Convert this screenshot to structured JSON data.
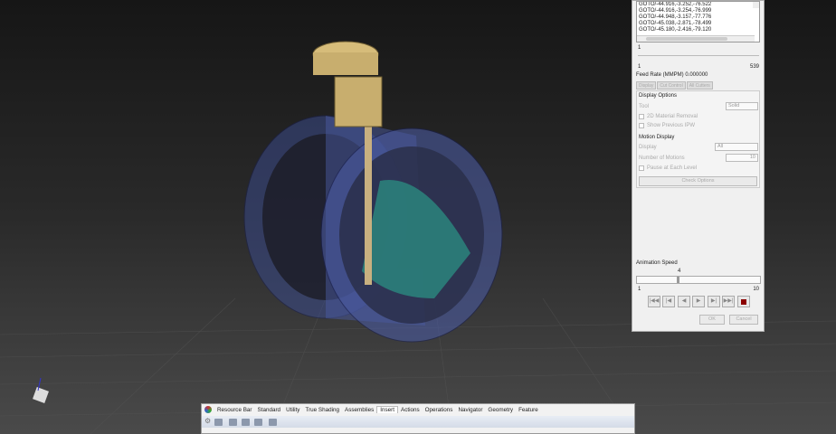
{
  "gcode_list": [
    "GOTO/-44.916,-3.252,-76.522",
    "GOTO/-44.916,-3.254,-76.999",
    "GOTO/-44.948,-3.157,-77.776",
    "GOTO/-45.038,-2.871,-78.499",
    "GOTO/-45.180,-2.416,-79.120"
  ],
  "motion": {
    "current": "1",
    "min": "1",
    "max": "539",
    "position_fraction": 0.0
  },
  "feed_rate": "Feed Rate (MMPM) 0.000000",
  "tabs": [
    "Display",
    "Cut Control",
    "All Cutters"
  ],
  "display_options": {
    "title": "Display Options",
    "tool_label": "Tool",
    "tool_value": "Solid",
    "material_removal": "2D Material Removal",
    "show_previous": "Show Previous IPW"
  },
  "motion_display": {
    "title": "Motion Display",
    "display_label": "Display",
    "display_value": "All",
    "num_motions_label": "Number of Motions",
    "num_motions_value": "10",
    "pause_label": "Pause at Each Level",
    "check_options": "Check Options"
  },
  "animation": {
    "label": "Animation Speed",
    "value": "4",
    "min": "1",
    "max": "10",
    "fraction": 0.33
  },
  "buttons": {
    "ok": "OK",
    "cancel": "Cancel"
  },
  "toolbar": {
    "tabs": [
      "Resource Bar",
      "Standard",
      "Utility",
      "True Shading",
      "Assemblies",
      "Insert",
      "Actions",
      "Operations",
      "Navigator",
      "Geometry",
      "Feature"
    ],
    "active": "Insert"
  },
  "colors": {
    "part": "#4a5aa0",
    "tool": "#c8b070",
    "stop": "#8b0000"
  }
}
